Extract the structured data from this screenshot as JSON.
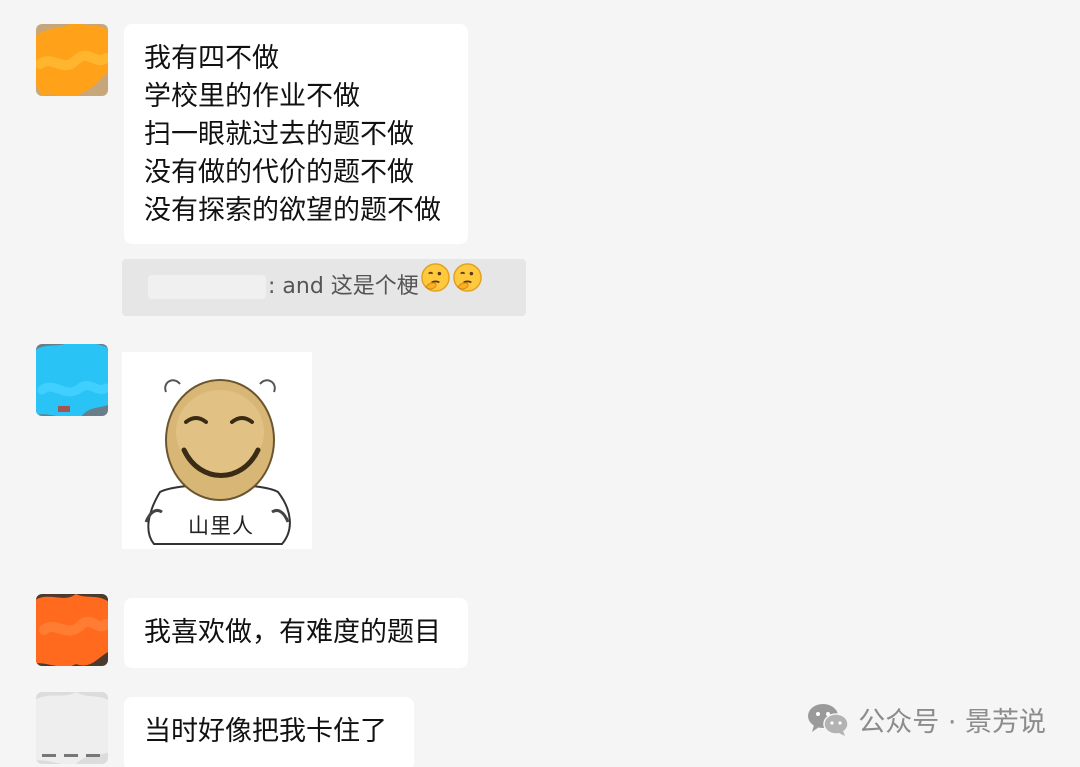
{
  "messages": [
    {
      "lines": [
        "我有四不做",
        "学校里的作业不做",
        "扫一眼就过去的题不做",
        "没有做的代价的题不做",
        "没有探索的欲望的题不做"
      ],
      "avatar_color": "#ffa21a"
    },
    {
      "quote_text": ": and 这是个梗",
      "quote_emoji": "thinking-face-icon"
    },
    {
      "sticker_label": "山里人",
      "avatar_color": "#29c3f5"
    },
    {
      "text": "我喜欢做，有难度的题目",
      "avatar_color": "#ff6a1f"
    },
    {
      "text": "当时好像把我卡住了",
      "avatar_color": "#e9e9e9"
    }
  ],
  "watermark": {
    "text": "公众号 · 景芳说",
    "icon": "wechat-icon"
  }
}
